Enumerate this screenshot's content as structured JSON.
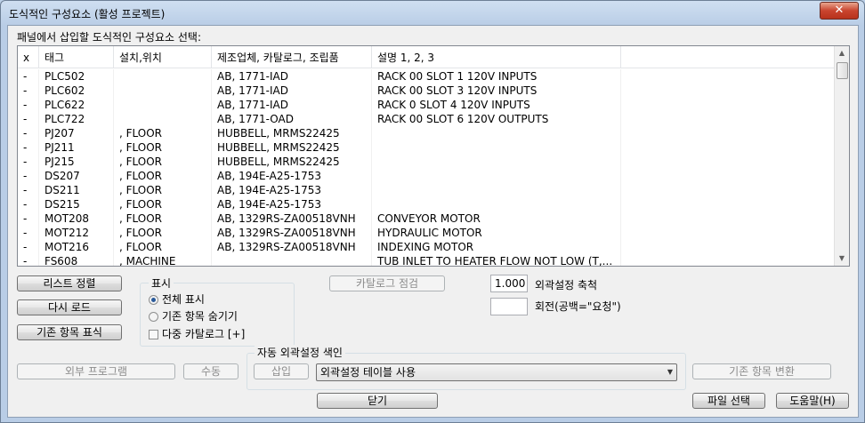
{
  "window": {
    "title": "도식적인 구성요소 (활성 프로젝트)",
    "close_glyph": "✕"
  },
  "prompt": "패널에서 삽입할 도식적인 구성요소 선택:",
  "table": {
    "columns": [
      "x",
      "태그",
      "설치,위치",
      "제조업체, 카탈로그, 조립품",
      "설명 1, 2, 3",
      ""
    ],
    "rows": [
      [
        "-",
        "PLC502",
        "",
        "AB, 1771-IAD",
        "RACK 00 SLOT 1 120V INPUTS",
        ""
      ],
      [
        "-",
        "PLC602",
        "",
        "AB, 1771-IAD",
        "RACK 00 SLOT 3 120V INPUTS",
        ""
      ],
      [
        "-",
        "PLC622",
        "",
        "AB, 1771-IAD",
        "RACK 0 SLOT 4 120V INPUTS",
        ""
      ],
      [
        "-",
        "PLC722",
        "",
        "AB, 1771-OAD",
        "RACK 00 SLOT 6 120V OUTPUTS",
        ""
      ],
      [
        "-",
        "PJ207",
        ", FLOOR",
        "HUBBELL, MRMS22425",
        "",
        ""
      ],
      [
        "-",
        "PJ211",
        ", FLOOR",
        "HUBBELL, MRMS22425",
        "",
        ""
      ],
      [
        "-",
        "PJ215",
        ", FLOOR",
        "HUBBELL, MRMS22425",
        "",
        ""
      ],
      [
        "-",
        "DS207",
        ", FLOOR",
        "AB, 194E-A25-1753",
        "",
        ""
      ],
      [
        "-",
        "DS211",
        ", FLOOR",
        "AB, 194E-A25-1753",
        "",
        ""
      ],
      [
        "-",
        "DS215",
        ", FLOOR",
        "AB, 194E-A25-1753",
        "",
        ""
      ],
      [
        "-",
        "MOT208",
        ", FLOOR",
        "AB, 1329RS-ZA00518VNH",
        "CONVEYOR MOTOR",
        ""
      ],
      [
        "-",
        "MOT212",
        ", FLOOR",
        "AB, 1329RS-ZA00518VNH",
        "HYDRAULIC MOTOR",
        ""
      ],
      [
        "-",
        "MOT216",
        ", FLOOR",
        "AB, 1329RS-ZA00518VNH",
        "INDEXING MOTOR",
        ""
      ],
      [
        "-",
        "FS608",
        ", MACHINE",
        "",
        "TUB INLET TO HEATER FLOW NOT LOW (T,...",
        ""
      ]
    ]
  },
  "scrollbar": {
    "up_glyph": "▲",
    "down_glyph": "▼"
  },
  "buttons": {
    "sort_list": "리스트 정렬",
    "reload": "다시 로드",
    "mark_existing": "기존 항목 표식",
    "catalog_check": "카탈로그 점검",
    "external_program": "외부 프로그램",
    "manual": "수동",
    "insert": "삽입",
    "convert_existing": "기존 항목 변환",
    "close": "닫기",
    "select_file": "파일 선택",
    "help": "도움말(H)"
  },
  "display_group": {
    "label": "표시",
    "options": [
      {
        "label": "전체 표시",
        "selected": true
      },
      {
        "label": "기존 항목 숨기기",
        "selected": false
      }
    ],
    "multi_catalog": {
      "label": "다중 카탈로그 [+]",
      "checked": false
    }
  },
  "scale": {
    "value": "1.000",
    "label": "외곽설정 축척"
  },
  "rotation": {
    "value": "",
    "label": "회전(공백=\"요청\")"
  },
  "auto_index": {
    "label": "자동 외곽설정 색인",
    "combo_value": "외곽설정 테이블 사용",
    "combo_arrow": "▼"
  }
}
